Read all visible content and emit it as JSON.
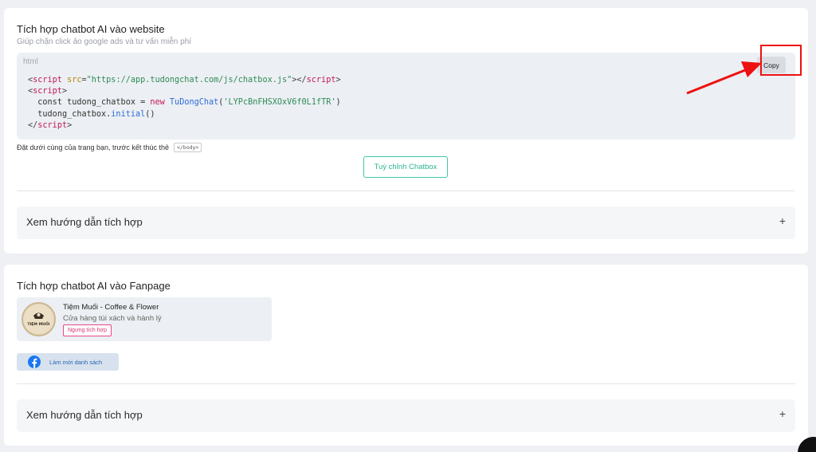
{
  "website_section": {
    "title": "Tích hợp chatbot AI vào website",
    "subtitle": "Giúp chặn click ảo google ads và tư vấn miễn phí",
    "code_language": "html",
    "copy_label": "Copy",
    "code": {
      "line1_src_url": "\"https://app.tudongchat.com/js/chatbox.js\"",
      "var_name": "tudong_chatbox",
      "class_name": "TuDongChat",
      "token": "'LYPcBnFHSXOxV6f0L1fTR'",
      "method": "initial"
    },
    "hint_text": "Đặt dưới cùng của trang bạn, trước kết thúc thẻ",
    "hint_tag": "</body>",
    "customize_label": "Tuỳ chỉnh Chatbox",
    "guide_label": "Xem hướng dẫn tích hợp",
    "guide_toggle": "+"
  },
  "fanpage_section": {
    "title": "Tích hợp chatbot AI vào Fanpage",
    "page": {
      "name": "Tiệm Muối - Coffee & Flower",
      "description": "Cửa hàng túi xách và hành lý",
      "status_badge": "Ngưng tích hợp",
      "avatar_text": "TIỆM MUỐI"
    },
    "refresh_label": "Làm mới danh sách",
    "guide_label": "Xem hướng dẫn tích hợp",
    "guide_toggle": "+"
  },
  "icons": {
    "facebook": "facebook-icon",
    "plus": "plus-icon"
  },
  "colors": {
    "accent_green": "#3ec9a7",
    "annotation_red": "#ee1111",
    "facebook_blue": "#1877f2",
    "badge_pink": "#e8478b"
  }
}
